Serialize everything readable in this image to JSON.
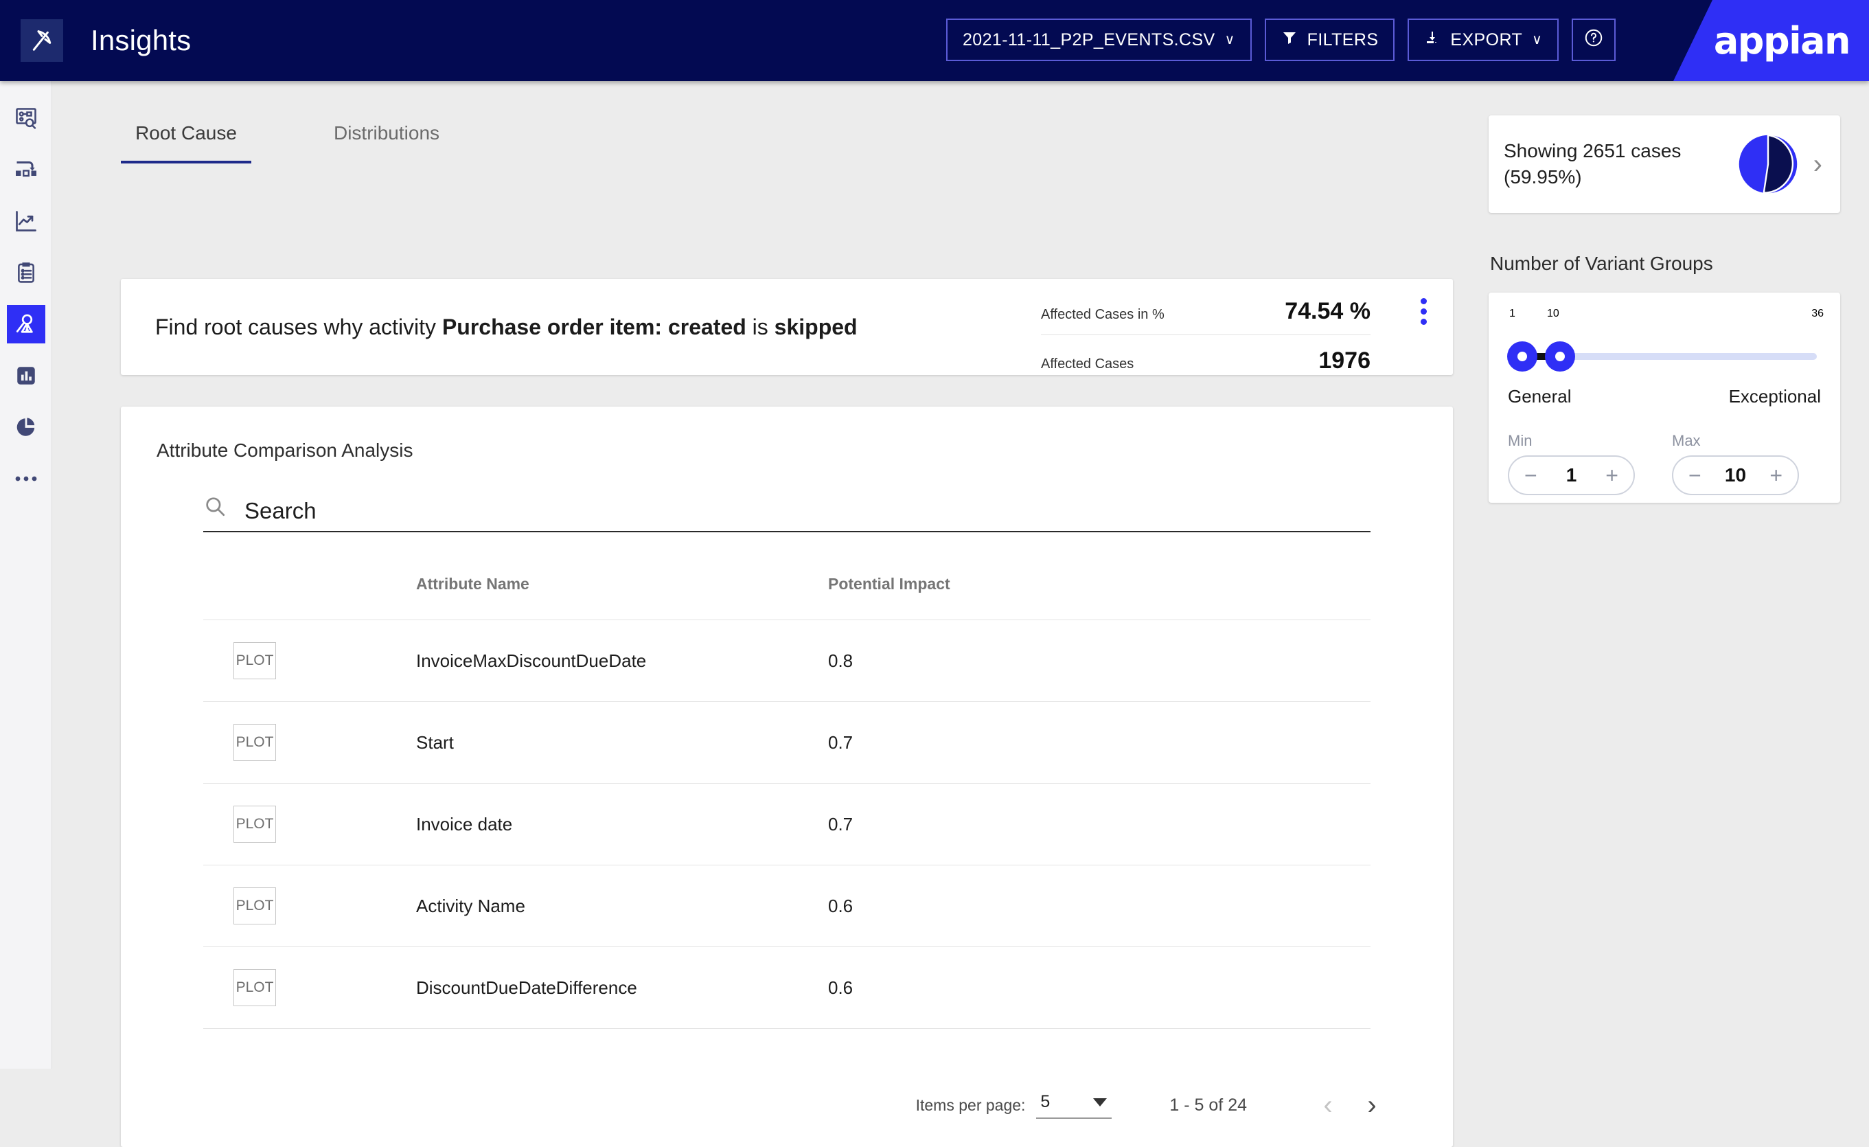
{
  "header": {
    "app_title": "Insights",
    "logo_icon": "pickaxe-logo-icon",
    "brand_name": "appian",
    "file_select": {
      "label": "2021-11-11_P2P_EVENTS.CSV",
      "caret": "∨"
    },
    "filters_button": {
      "label": "FILTERS",
      "icon": "filter-funnel-icon"
    },
    "export_button": {
      "label": "EXPORT",
      "icon": "download-icon",
      "caret": "∨"
    },
    "help_button": {
      "icon": "help-circle-icon",
      "label": "?"
    }
  },
  "sidebar": {
    "items": [
      {
        "name": "process-discovery",
        "icon": "process-search-icon",
        "active": false
      },
      {
        "name": "process-map",
        "icon": "process-flow-icon",
        "active": false
      },
      {
        "name": "trends",
        "icon": "trend-chart-icon",
        "active": false
      },
      {
        "name": "cases",
        "icon": "clipboard-list-icon",
        "active": false
      },
      {
        "name": "root-cause",
        "icon": "root-cause-icon",
        "active": true
      },
      {
        "name": "bar-analytics",
        "icon": "bar-chart-icon",
        "active": false
      },
      {
        "name": "pie-analytics",
        "icon": "pie-chart-icon",
        "active": false
      },
      {
        "name": "more",
        "icon": "more-dots-icon",
        "active": false
      }
    ]
  },
  "tabs": [
    {
      "label": "Root Cause",
      "active": true
    },
    {
      "label": "Distributions",
      "active": false
    }
  ],
  "root_cause_card": {
    "question_prefix": "Find root causes why activity ",
    "question_activity": "Purchase order item: created",
    "question_middle": " is ",
    "question_state": "skipped",
    "stats": [
      {
        "label": "Affected Cases in %",
        "value": "74.54 %"
      },
      {
        "label": "Affected Cases",
        "value": "1976"
      }
    ],
    "menu_icon": "kebab-menu-icon"
  },
  "attribute_table": {
    "title": "Attribute Comparison Analysis",
    "search": {
      "placeholder": "Search",
      "value": "",
      "icon": "search-icon"
    },
    "columns": [
      "",
      "Attribute Name",
      "Potential Impact"
    ],
    "plot_label": "PLOT",
    "rows": [
      {
        "plot": "PLOT",
        "attribute_name": "InvoiceMaxDiscountDueDate",
        "potential_impact": "0.8"
      },
      {
        "plot": "PLOT",
        "attribute_name": "Start",
        "potential_impact": "0.7"
      },
      {
        "plot": "PLOT",
        "attribute_name": "Invoice date",
        "potential_impact": "0.7"
      },
      {
        "plot": "PLOT",
        "attribute_name": "Activity Name",
        "potential_impact": "0.6"
      },
      {
        "plot": "PLOT",
        "attribute_name": "DiscountDueDateDifference",
        "potential_impact": "0.6"
      }
    ],
    "paginator": {
      "items_per_page_label": "Items per page:",
      "items_per_page_value": "5",
      "range_label": "1 - 5 of 24",
      "prev_icon": "chevron-left-icon",
      "next_icon": "chevron-right-icon"
    }
  },
  "right_panel": {
    "cases_card": {
      "line1": "Showing 2651 cases",
      "line2": "(59.95%)",
      "chevron_icon": "chevron-right-icon",
      "pie": {
        "shown_percent": 59.95,
        "shown_color": "#0a0f4f",
        "rest_color": "#2f2ff5"
      }
    },
    "variant_groups": {
      "title": "Number of Variant Groups",
      "scale_min": "1",
      "scale_current": "10",
      "scale_max": "36",
      "left_label": "General",
      "right_label": "Exceptional",
      "min": {
        "label": "Min",
        "value": "1",
        "decrement": "−",
        "increment": "+"
      },
      "max": {
        "label": "Max",
        "value": "10",
        "decrement": "−",
        "increment": "+"
      }
    }
  },
  "colors": {
    "header_navy": "#030a52",
    "accent_blue": "#2f2ff5",
    "page_bg": "#ececec",
    "tab_underline": "#1e2a8a"
  }
}
